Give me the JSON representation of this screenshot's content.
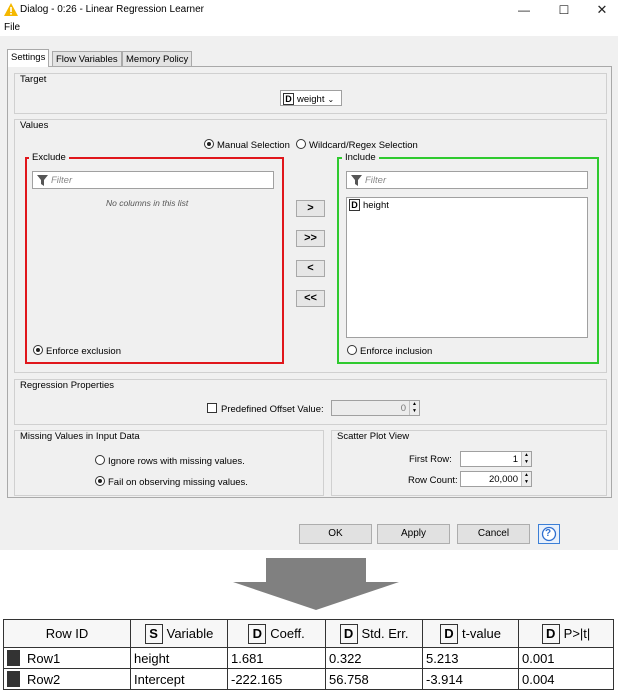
{
  "window": {
    "title": "Dialog - 0:26 - Linear Regression Learner",
    "menu": [
      "File"
    ]
  },
  "tabs": [
    {
      "label": "Settings",
      "active": true
    },
    {
      "label": "Flow Variables",
      "active": false
    },
    {
      "label": "Memory Policy",
      "active": false
    }
  ],
  "target": {
    "section_label": "Target",
    "type_badge": "D",
    "column": "weight"
  },
  "values": {
    "section_label": "Values",
    "mode_options": [
      "Manual Selection",
      "Wildcard/Regex Selection"
    ],
    "mode_selected": "Manual Selection",
    "exclude": {
      "title": "Exclude",
      "filter_placeholder": "Filter",
      "empty_text": "No columns in this list",
      "enforce_label": "Enforce exclusion",
      "enforce_selected": true
    },
    "include": {
      "title": "Include",
      "filter_placeholder": "Filter",
      "columns": [
        {
          "type": "D",
          "name": "height"
        }
      ],
      "enforce_label": "Enforce inclusion",
      "enforce_selected": false
    },
    "move_buttons": [
      ">",
      ">>",
      "<",
      "<<"
    ]
  },
  "regression": {
    "section_label": "Regression Properties",
    "offset_label": "Predefined Offset Value:",
    "offset_checked": false,
    "offset_value": "0"
  },
  "missing": {
    "section_label": "Missing Values in Input Data",
    "options": [
      "Ignore rows with missing values.",
      "Fail on observing missing values."
    ],
    "selected": "Fail on observing missing values."
  },
  "scatter": {
    "section_label": "Scatter Plot View",
    "first_row_label": "First Row:",
    "first_row_value": "1",
    "row_count_label": "Row Count:",
    "row_count_value": "20,000"
  },
  "buttons": {
    "ok": "OK",
    "apply": "Apply",
    "cancel": "Cancel",
    "help": "?"
  },
  "colors": {
    "exclude_border": "#e0161b",
    "include_border": "#2fca2f",
    "warning": "#f5b800",
    "arrow": "#808080"
  },
  "result_table": {
    "columns": [
      {
        "type": "",
        "label": "Row ID"
      },
      {
        "type": "S",
        "label": "Variable"
      },
      {
        "type": "D",
        "label": "Coeff."
      },
      {
        "type": "D",
        "label": "Std. Err."
      },
      {
        "type": "D",
        "label": "t-value"
      },
      {
        "type": "D",
        "label": "P>|t|"
      }
    ],
    "rows": [
      [
        "Row1",
        "height",
        "1.681",
        "0.322",
        "5.213",
        "0.001"
      ],
      [
        "Row2",
        "Intercept",
        "-222.165",
        "56.758",
        "-3.914",
        "0.004"
      ]
    ]
  }
}
